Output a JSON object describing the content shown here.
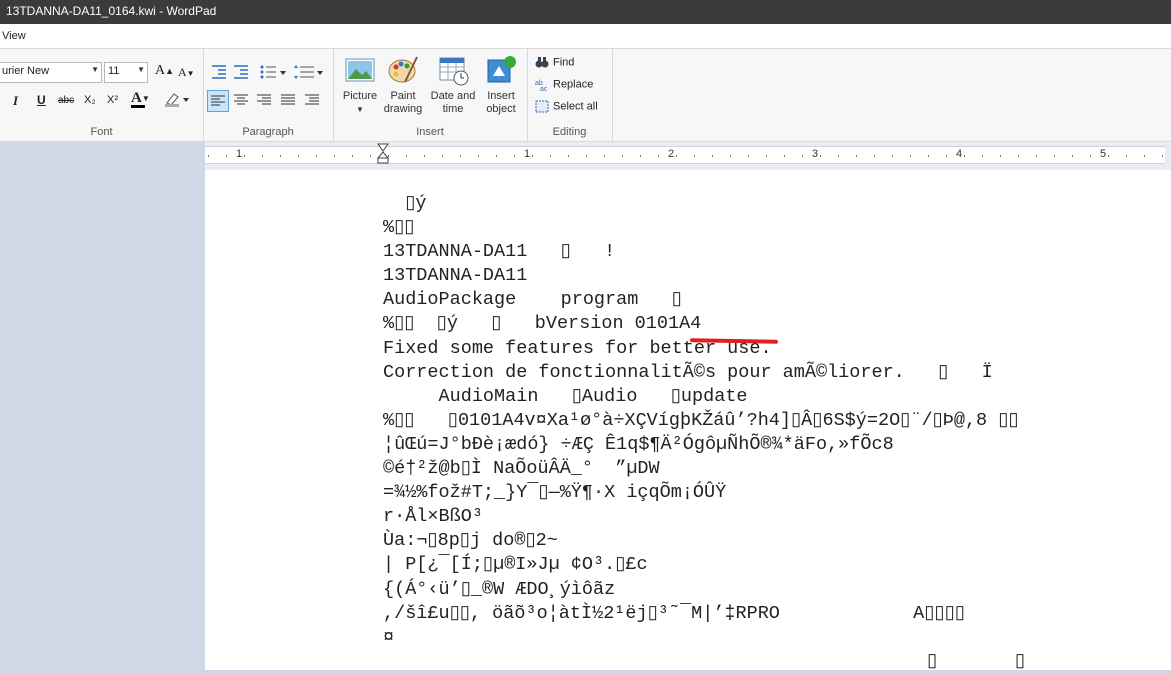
{
  "window": {
    "title": "13TDANNA-DA11_0164.kwi - WordPad"
  },
  "menu": {
    "view_tab": "View"
  },
  "font_group": {
    "label": "Font",
    "font_name": "urier New",
    "font_size": "11",
    "grow_label": "A",
    "shrink_label": "A",
    "italic": "I",
    "underline": "U",
    "strike": "abc",
    "sub": "X₂",
    "sup": "X²",
    "color_label": "A"
  },
  "paragraph_group": {
    "label": "Paragraph"
  },
  "insert_group": {
    "label": "Insert",
    "picture": "Picture",
    "paint1": "Paint",
    "paint2": "drawing",
    "date1": "Date and",
    "date2": "time",
    "obj1": "Insert",
    "obj2": "object"
  },
  "editing_group": {
    "label": "Editing",
    "find": "Find",
    "replace": "Replace",
    "select_all": "Select all"
  },
  "ruler": {
    "numbers": [
      "1",
      "1",
      "2",
      "3",
      "4",
      "5"
    ]
  },
  "document": {
    "lines": [
      "  ▯ý",
      "%▯▯",
      "13TDANNA-DA11   ▯   !",
      "13TDANNA-DA11",
      "AudioPackage    program   ▯",
      "%▯▯  ▯ý   ▯   bVersion 0101A4",
      "Fixed some features for better use.",
      "Correction de fonctionnalitÃ©s pour amÃ©liorer.   ▯   Ï",
      "     AudioMain   ▯Audio   ▯update",
      "%▯▯   ▯0101A4v¤Xa¹ø°à÷XÇVígþKŽáû’?h4]▯Â▯6S$ý=2O▯¨/▯Þ@,8 ▯▯",
      "¦ûŒú=J°bÐè¡ædó} ÷ÆÇ Ê1q$¶Ä²ÓgôµÑhÕ®¾*äFo,»fÕc8",
      "©é†²ž@b▯Ì NaÕoüÂÄ_°  ”µDW",
      "=¾½%fož#T;_}Y¯▯—%Ÿ¶·X içqÕm¡ÓÛŸ",
      "r·Ål×BßO³",
      "Ùa:¬▯8p▯j do®▯2~",
      "| P[¿¯[Í;▯µ®I»Jµ ¢O³.▯£c",
      "{(Á°‹ü’▯_®W ÆDO¸ýìôãz",
      ",/šî£u▯▯, öãõ³o¦àtÌ½2¹ëj▯³˜¯M|’‡RPRO            A▯▯▯▯",
      "¤",
      "                                                 ▯       ▯"
    ]
  },
  "colors": {
    "titlebar": "#3b3b3b",
    "ribbon": "#f7f7f7",
    "annotation": "#e02020"
  }
}
